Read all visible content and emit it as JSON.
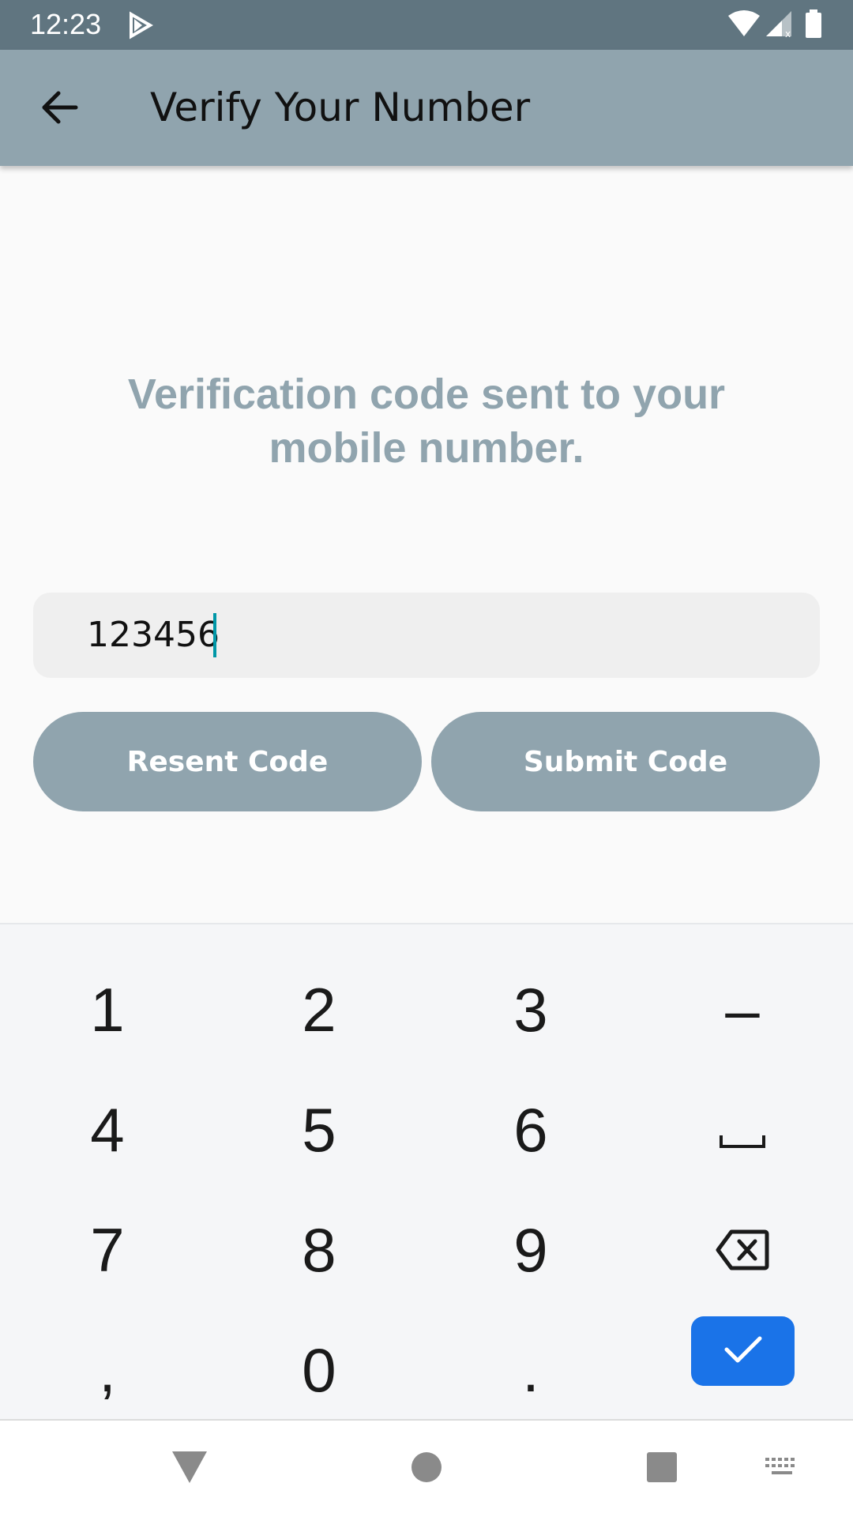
{
  "status_bar": {
    "time": "12:23",
    "icons": [
      "play-store-icon",
      "wifi-icon",
      "signal-icon",
      "battery-icon"
    ]
  },
  "app_bar": {
    "title": "Verify Your Number",
    "back_icon": "arrow-back-icon"
  },
  "main": {
    "message": "Verification code sent to your mobile number.",
    "code_input": {
      "value": "123456"
    },
    "resend_label": "Resent Code",
    "submit_label": "Submit Code"
  },
  "keyboard": {
    "keys": [
      "1",
      "2",
      "3",
      "–",
      "4",
      "5",
      "6",
      "␣",
      "7",
      "8",
      "9",
      "⌫",
      ",",
      "0",
      ".",
      "✓"
    ],
    "enter_color": "#1a73e8"
  },
  "nav_bar": {
    "buttons": [
      "back-triangle-icon",
      "home-circle-icon",
      "recents-square-icon",
      "keyboard-switch-icon"
    ]
  },
  "colors": {
    "status_bar": "#607580",
    "app_bar": "#90a4ae",
    "accent": "#90a4ae",
    "caret": "#0097a7"
  }
}
